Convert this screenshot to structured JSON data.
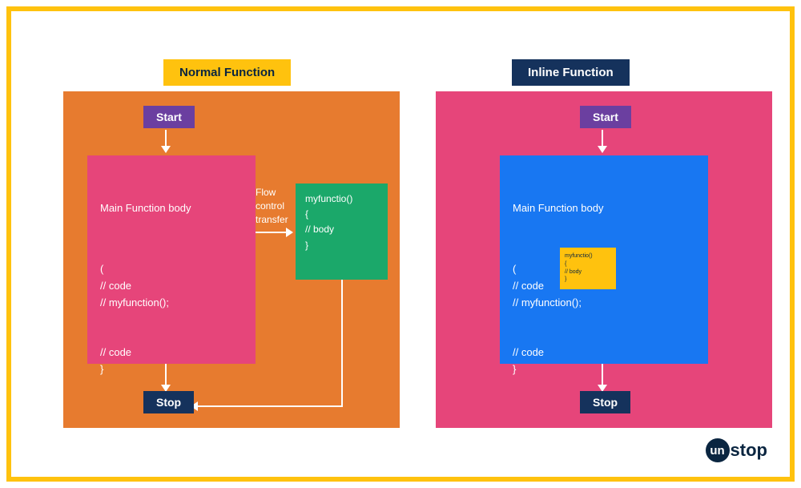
{
  "headers": {
    "normal": "Normal Function",
    "inline": "Inline Function"
  },
  "badges": {
    "start": "Start",
    "stop": "Stop"
  },
  "normal": {
    "main_title": "Main Function body",
    "main_code": "(\n// code\n// myfunction();\n\n\n// code\n}",
    "flow_label": "Flow control transfer",
    "side_code": "myfunctio()\n{\n// body\n}"
  },
  "inline": {
    "main_title": "Main Function body",
    "main_code": "(\n// code\n// myfunction();\n\n\n// code\n}",
    "note_code": "myfunctio()\n{\n// body\n}"
  },
  "logo": {
    "circle": "un",
    "text": "stop"
  },
  "colors": {
    "frame_border": "#ffc20e",
    "panel_left": "#e77b2f",
    "panel_right": "#e6457a",
    "start_badge": "#6b3fa0",
    "stop_badge": "#15325c",
    "main_box_left": "#e6457a",
    "main_box_right": "#1877f2",
    "side_box": "#1ba86a",
    "inline_note": "#ffc20e"
  }
}
